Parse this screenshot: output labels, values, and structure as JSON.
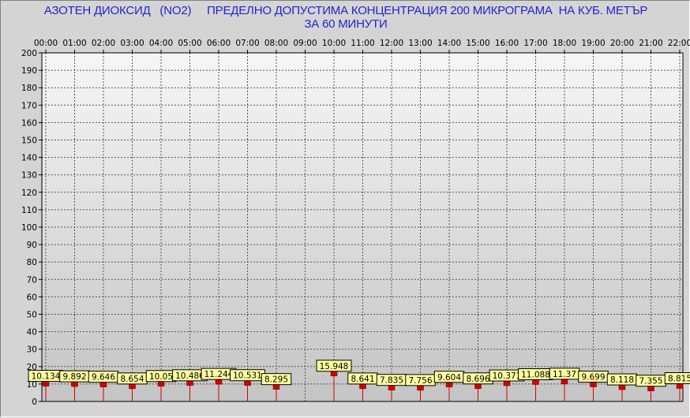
{
  "title": {
    "line1": "АЗОТЕН ДИОКСИД   (NO2)     ПРЕДЕЛНО ДОПУСТИМА КОНЦЕНТРАЦИЯ 200 МИКРОГРАМА  НА КУБ. МЕТЪР",
    "line2": "ЗА 60 МИНУТИ"
  },
  "colors": {
    "title": "#2323d0",
    "marker": "#d40000",
    "label_bg": "#ffffa0",
    "plot_bg_top": "#f6f6f6",
    "plot_bg_bottom": "#c4c4c4"
  },
  "chart_data": {
    "type": "bar",
    "title": "АЗОТЕН ДИОКСИД   (NO2)     ПРЕДЕЛНО ДОПУСТИМА КОНЦЕНТРАЦИЯ 200 МИКРОГРАМА  НА КУБ. МЕТЪР ЗА 60 МИНУТИ",
    "categories": [
      "00:00",
      "01:00",
      "02:00",
      "03:00",
      "04:00",
      "05:00",
      "06:00",
      "07:00",
      "08:00",
      "09:00",
      "10:00",
      "11:00",
      "12:00",
      "13:00",
      "14:00",
      "15:00",
      "16:00",
      "17:00",
      "18:00",
      "19:00",
      "20:00",
      "21:00",
      "22:00"
    ],
    "values": [
      10.134,
      9.892,
      9.646,
      8.654,
      10.05,
      10.486,
      11.244,
      10.531,
      8.295,
      null,
      15.948,
      8.641,
      7.835,
      7.756,
      9.604,
      8.696,
      10.371,
      11.088,
      11.37,
      9.699,
      8.118,
      7.355,
      8.815
    ],
    "value_labels": [
      "10.134",
      "9.892",
      "9.646",
      "8.654",
      "10.05",
      "10.486",
      "11.244",
      "10.531",
      "8.295",
      "",
      "15.948",
      "8.641",
      "7.835",
      "7.756",
      "9.604",
      "8.696",
      "10.371",
      "11.088",
      "11.37",
      "9.699",
      "8.118",
      "7.355",
      "8.815"
    ],
    "yticks": [
      "0",
      "10",
      "20",
      "30",
      "40",
      "50",
      "60",
      "70",
      "80",
      "90",
      "100",
      "110",
      "120",
      "130",
      "140",
      "150",
      "160",
      "170",
      "180",
      "190",
      "200"
    ],
    "ylim": [
      0,
      200
    ],
    "grid": true,
    "xaxis_position": "top"
  }
}
